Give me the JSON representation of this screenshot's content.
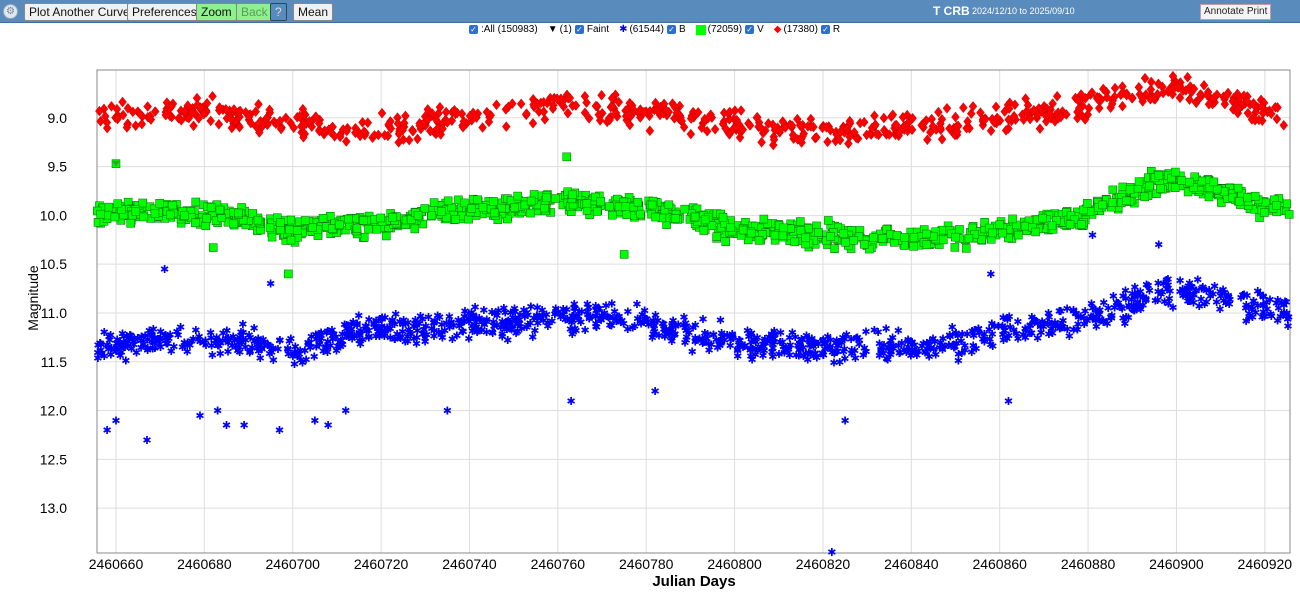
{
  "toolbar": {
    "plot_another": "Plot Another Curve",
    "preferences": "Preferences",
    "zoom": "Zoom",
    "back": "Back",
    "help": "?",
    "mean": "Mean",
    "star": "T CRB",
    "date_range": "2024/12/10 to 2025/09/10",
    "annotate": "Annotate Print"
  },
  "legend": {
    "all": ":All (150983)",
    "faint_count": "(1)",
    "faint": "Faint",
    "b_count": "(61544)",
    "b": "B",
    "v_count": "(72059)",
    "v": "V",
    "r_count": "(17380)",
    "r": "R"
  },
  "chart_data": {
    "type": "scatter",
    "title": "",
    "xlabel": "Julian Days",
    "ylabel": "Magnitude",
    "xlim": [
      2460655.7,
      2460925.7
    ],
    "ylim": [
      13.46,
      8.51
    ],
    "y_inverted": true,
    "grid": true,
    "xticks": [
      2460660,
      2460680,
      2460700,
      2460720,
      2460740,
      2460760,
      2460780,
      2460800,
      2460820,
      2460840,
      2460860,
      2460880,
      2460900,
      2460920
    ],
    "yticks": [
      9.0,
      9.5,
      10.0,
      10.5,
      11.0,
      11.5,
      12.0,
      12.5,
      13.0
    ],
    "series": [
      {
        "name": "R",
        "color": "#ff0000",
        "marker": "diamond",
        "trend_x": [
          2460656,
          2460670,
          2460680,
          2460690,
          2460700,
          2460710,
          2460720,
          2460730,
          2460740,
          2460750,
          2460760,
          2460770,
          2460780,
          2460790,
          2460800,
          2460810,
          2460820,
          2460830,
          2460840,
          2460850,
          2460860,
          2460870,
          2460880,
          2460890,
          2460900,
          2460910,
          2460920,
          2460926
        ],
        "trend_y": [
          9.0,
          8.95,
          8.92,
          9.0,
          9.05,
          9.1,
          9.12,
          9.05,
          9.0,
          8.95,
          8.85,
          8.9,
          8.95,
          9.0,
          9.1,
          9.12,
          9.12,
          9.12,
          9.1,
          9.05,
          9.0,
          8.95,
          8.85,
          8.75,
          8.72,
          8.8,
          8.92,
          9.0
        ],
        "scatter": 0.12
      },
      {
        "name": "V",
        "color": "#00ff00",
        "marker": "square",
        "trend_x": [
          2460656,
          2460670,
          2460680,
          2460690,
          2460700,
          2460710,
          2460720,
          2460730,
          2460740,
          2460750,
          2460760,
          2460770,
          2460780,
          2460790,
          2460800,
          2460810,
          2460820,
          2460830,
          2460840,
          2460850,
          2460860,
          2460870,
          2460880,
          2460890,
          2460895,
          2460900,
          2460910,
          2460920,
          2460926
        ],
        "trend_y": [
          10.0,
          9.95,
          10.0,
          10.05,
          10.15,
          10.1,
          10.1,
          10.0,
          9.95,
          9.9,
          9.85,
          9.88,
          9.92,
          10.0,
          10.15,
          10.18,
          10.2,
          10.22,
          10.25,
          10.22,
          10.15,
          10.1,
          10.0,
          9.8,
          9.65,
          9.65,
          9.75,
          9.9,
          9.95
        ],
        "scatter": 0.1,
        "outliers": [
          [
            2460660,
            9.47
          ],
          [
            2460699,
            10.6
          ],
          [
            2460682,
            10.33
          ],
          [
            2460762,
            9.4
          ],
          [
            2460775,
            10.4
          ]
        ]
      },
      {
        "name": "B",
        "color": "#0000ff",
        "marker": "star",
        "trend_x": [
          2460656,
          2460670,
          2460680,
          2460690,
          2460700,
          2460710,
          2460720,
          2460730,
          2460740,
          2460750,
          2460760,
          2460770,
          2460780,
          2460790,
          2460800,
          2460810,
          2460820,
          2460830,
          2460840,
          2460850,
          2460860,
          2460870,
          2460880,
          2460890,
          2460900,
          2460910,
          2460920,
          2460926
        ],
        "trend_y": [
          11.35,
          11.25,
          11.25,
          11.3,
          11.4,
          11.25,
          11.15,
          11.15,
          11.1,
          11.08,
          11.05,
          11.05,
          11.1,
          11.2,
          11.3,
          11.32,
          11.35,
          11.35,
          11.35,
          11.3,
          11.2,
          11.15,
          11.05,
          10.9,
          10.75,
          10.85,
          10.95,
          11.0
        ],
        "scatter": 0.13,
        "outliers": [
          [
            2460658,
            12.2
          ],
          [
            2460660,
            12.1
          ],
          [
            2460667,
            12.3
          ],
          [
            2460679,
            12.05
          ],
          [
            2460683,
            12.0
          ],
          [
            2460685,
            12.15
          ],
          [
            2460689,
            12.15
          ],
          [
            2460697,
            12.2
          ],
          [
            2460705,
            12.1
          ],
          [
            2460708,
            12.15
          ],
          [
            2460712,
            12.0
          ],
          [
            2460735,
            12.0
          ],
          [
            2460763,
            11.9
          ],
          [
            2460782,
            11.8
          ],
          [
            2460825,
            12.1
          ],
          [
            2460822,
            13.45
          ],
          [
            2460671,
            10.55
          ],
          [
            2460695,
            10.7
          ],
          [
            2460881,
            10.2
          ],
          [
            2460896,
            10.3
          ],
          [
            2460858,
            10.6
          ],
          [
            2460862,
            11.9
          ]
        ]
      }
    ]
  }
}
